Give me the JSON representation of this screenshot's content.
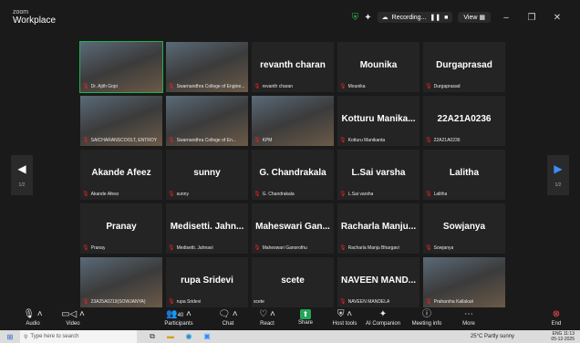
{
  "window": {
    "brand_small": "zoom",
    "brand_title": "Workplace",
    "recording_label": "Recording...",
    "view_label": "View"
  },
  "grid": {
    "tiles": [
      {
        "name": "",
        "label": "Dr. Ajith Gopi",
        "video": true
      },
      {
        "name": "",
        "label": "Swarnandhra College of Engine...",
        "video": true
      },
      {
        "name": "revanth charan",
        "label": "revanth charan"
      },
      {
        "name": "Mounika",
        "label": "Mounika"
      },
      {
        "name": "Durgaprasad",
        "label": "Durgaprasad"
      },
      {
        "name": "",
        "label": "SAICHARANSCOOLT, ENTROY",
        "video": true
      },
      {
        "name": "",
        "label": "Swarnandhra College of En...",
        "video": true
      },
      {
        "name": "",
        "label": "KPM",
        "video": true
      },
      {
        "name": "Kotturu Manika...",
        "label": "Kotturu Manikanta"
      },
      {
        "name": "22A21A0236",
        "label": "22A21A0236"
      },
      {
        "name": "Akande Afeez",
        "label": "Akande Afeez"
      },
      {
        "name": "sunny",
        "label": "sunny"
      },
      {
        "name": "G. Chandrakala",
        "label": "G. Chandrakala"
      },
      {
        "name": "L.Sai varsha",
        "label": "L.Sai varsha"
      },
      {
        "name": "Lalitha",
        "label": "Lalitha"
      },
      {
        "name": "Pranay",
        "label": "Pranay"
      },
      {
        "name": "Medisetti. Jahn...",
        "label": "Medisetti. Jahnavi"
      },
      {
        "name": "Maheswari Gan...",
        "label": "Maheswari Ganorothu"
      },
      {
        "name": "Racharla Manju...",
        "label": "Racharla Manju Bhargavi"
      },
      {
        "name": "Sowjanya",
        "label": "Sowjanya"
      },
      {
        "name": "",
        "label": "23A25A0219(SOWJANYA)",
        "video": true
      },
      {
        "name": "rupa Sridevi",
        "label": "rupa Sridevi"
      },
      {
        "name": "scete",
        "label": "scete"
      },
      {
        "name": "NAVEEN MAND...",
        "label": "NAVEEN MANDELA"
      },
      {
        "name": "",
        "label": "Praharsha Kallakuri",
        "video": true
      }
    ]
  },
  "pagination": {
    "left": "1/2",
    "right": "1/2"
  },
  "toolbar": {
    "audio": "Audio",
    "video": "Video",
    "participants": "Participants",
    "participants_count": "40",
    "chat": "Chat",
    "react": "React",
    "share": "Share",
    "host_tools": "Host tools",
    "ai_companion": "AI Companion",
    "meeting_info": "Meeting info",
    "more": "More",
    "end": "End"
  },
  "taskbar": {
    "search_placeholder": "Type here to search",
    "weather": "25°C Partly sunny",
    "lang": "ENG",
    "time": "11:13",
    "date": "05-12-2025"
  },
  "colors": {
    "background": "#1a1a1a",
    "tile": "#242424",
    "accent_green": "#23a55a",
    "end_red": "#ff4b4b",
    "mic_off_red": "#e22222",
    "nav_blue": "#3a8ef8"
  }
}
